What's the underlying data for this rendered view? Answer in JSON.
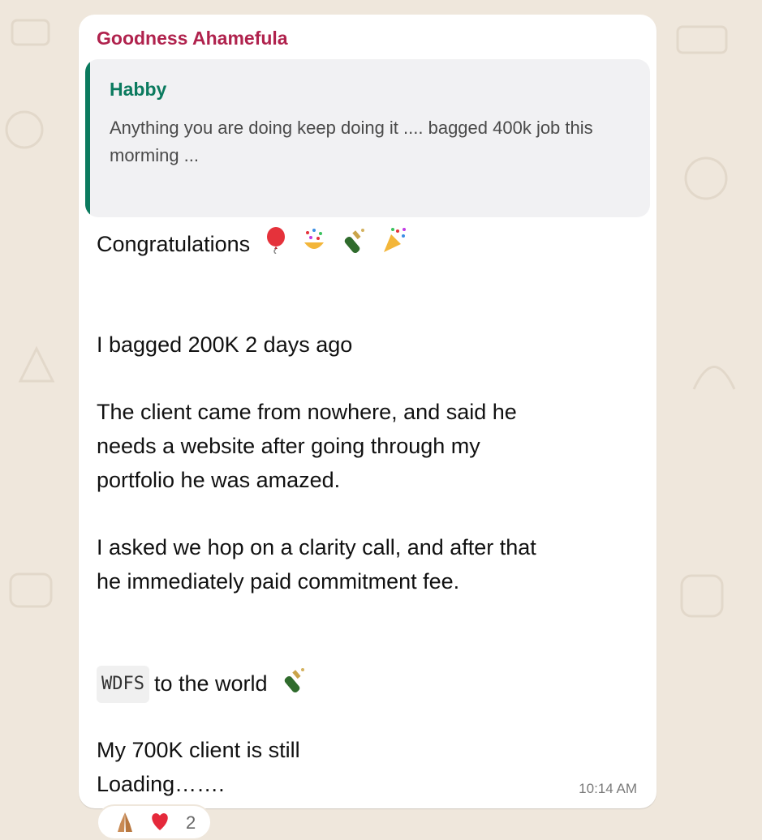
{
  "chat": {
    "sender": "Goodness Ahamefula",
    "quote": {
      "name": "Habby",
      "text": "Anything you are doing keep doing it .... bagged 400k job this morming ..."
    },
    "lines": {
      "line1": "Congratulations",
      "line2": "I bagged 200K 2 days ago",
      "line3": "The client came from nowhere, and said he",
      "line4": "needs a website after going through my",
      "line5": "portfolio he was amazed.",
      "line6": "I asked we hop on a clarity call,  and after that",
      "line7": "he immediately paid commitment fee.",
      "line8_code": "WDFS",
      "line8_text": "to the world",
      "line9": "My 700K client is still",
      "line10": "Loading……."
    },
    "time": "10:14 AM"
  },
  "reactions": {
    "count": "2",
    "icons": [
      "praying-hands-icon",
      "red-heart-icon"
    ]
  },
  "colors": {
    "sender": "#b0224d",
    "quote_accent": "#0b7a5e",
    "wallpaper": "#efe7dc"
  }
}
